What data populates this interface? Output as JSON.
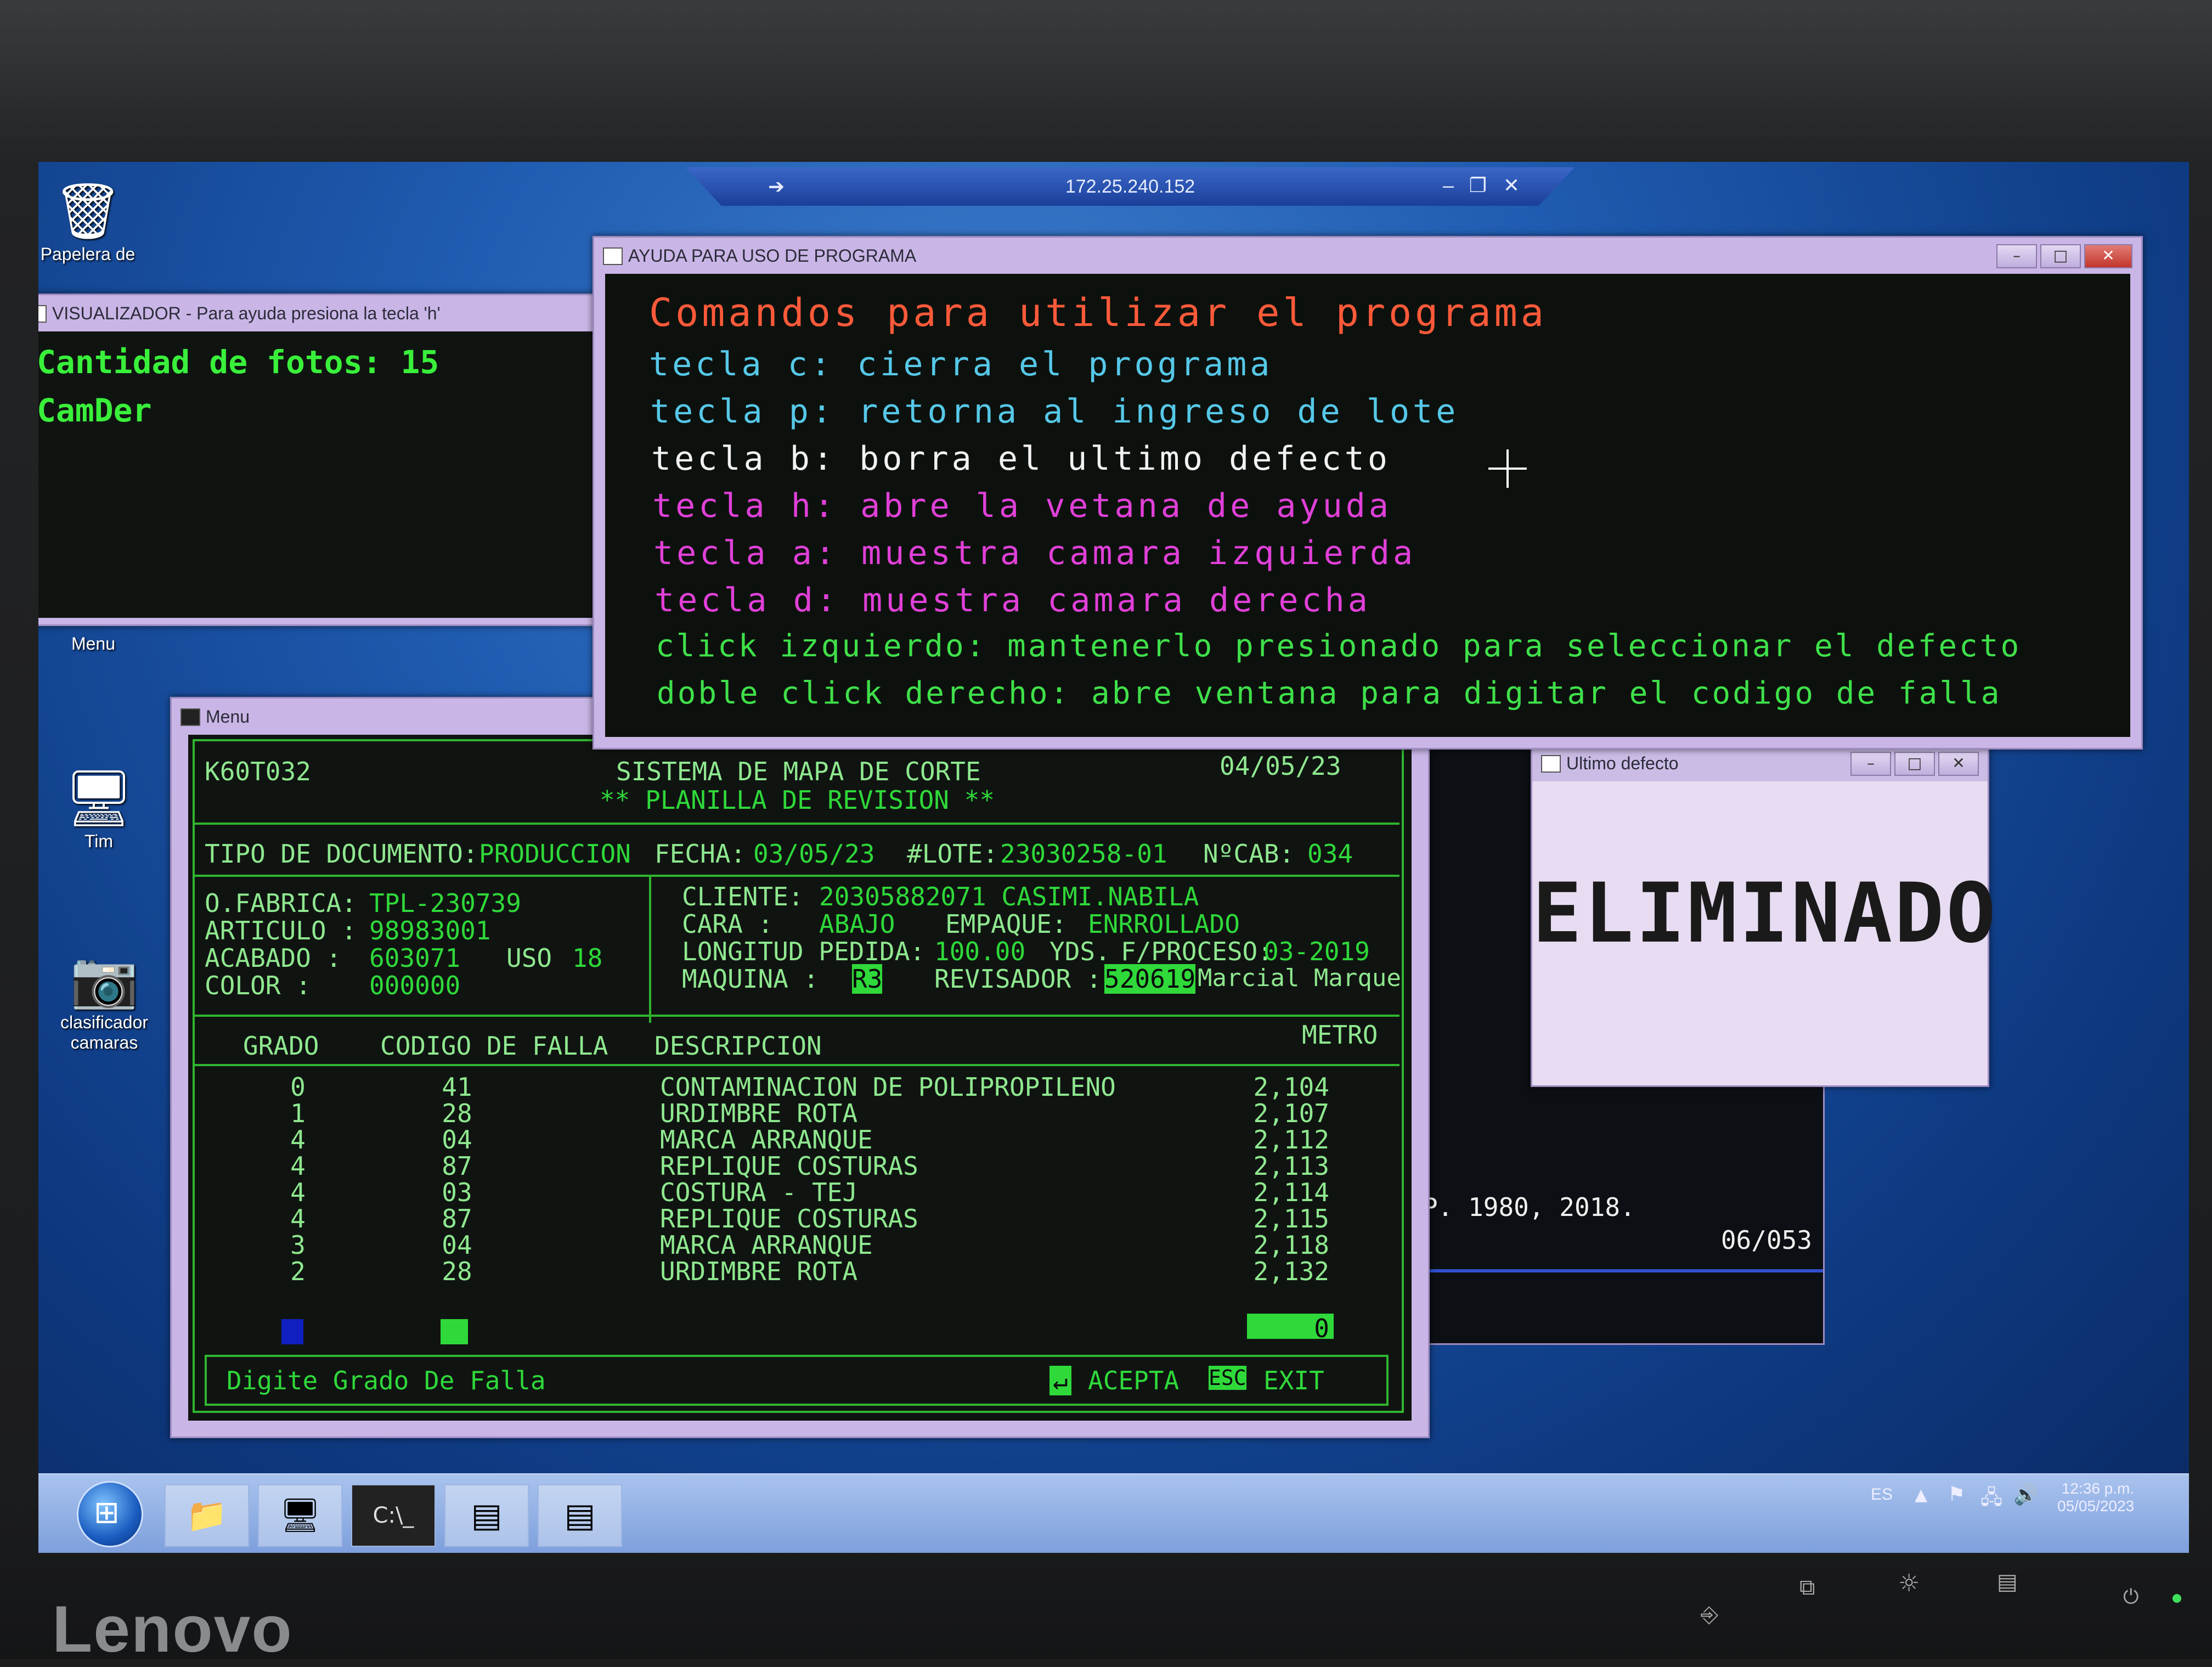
{
  "rdp": {
    "ip": "172.25.240.152",
    "pin_icon": "pin-icon",
    "min": "–",
    "restore": "❐",
    "close": "✕"
  },
  "desktop": {
    "recycle_label": "Papelera de",
    "menu_label": "Menu",
    "tim_label": "Tim",
    "clasificador_label": "clasificador camaras"
  },
  "visualizador": {
    "title": "VISUALIZADOR - Para ayuda presiona la tecla 'h'",
    "line1": "Cantidad de fotos: 15",
    "line2": "CamDer"
  },
  "help": {
    "title": "AYUDA PARA USO DE PROGRAMA",
    "heading": "Comandos para utilizar el programa",
    "lines": [
      {
        "text": "tecla c: cierra el programa",
        "color": "#56c8e8"
      },
      {
        "text": "tecla p: retorna al ingreso de lote",
        "color": "#56c8e8"
      },
      {
        "text": "tecla b: borra el ultimo defecto",
        "color": "#f2f2f2"
      },
      {
        "text": "tecla h: abre la vetana de ayuda",
        "color": "#e040d8"
      },
      {
        "text": "tecla a: muestra camara izquierda",
        "color": "#e040d8"
      },
      {
        "text": "tecla d: muestra camara derecha",
        "color": "#e040d8"
      },
      {
        "text": "click izquierdo: mantenerlo presionado para seleccionar el defecto",
        "color": "#3fe04a"
      },
      {
        "text": "doble click derecho: abre ventana para digitar el codigo de falla",
        "color": "#3fe04a"
      }
    ],
    "heading_color": "#ff5a3a"
  },
  "ultimo": {
    "title": "Ultimo defecto",
    "text": "ELIMINADO"
  },
  "bg_term": {
    "line1": "P. 1980, 2018.",
    "line2": "06/053"
  },
  "menu": {
    "title": "Menu",
    "program": "K60T032",
    "system": "SISTEMA DE MAPA DE CORTE",
    "subtitle": "** PLANILLA DE REVISION **",
    "date": "04/05/23",
    "tipo_label": "TIPO DE DOCUMENTO:",
    "tipo_value": "PRODUCCION",
    "fecha_label": "FECHA:",
    "fecha_value": "03/05/23",
    "lote_label": "#LOTE:",
    "lote_value": "23030258-01",
    "cab_label": "NºCAB:",
    "cab_value": "034",
    "ofab_label": "O.FABRICA:",
    "ofab_value": "TPL-230739",
    "art_label": "ARTICULO :",
    "art_value": "98983001",
    "acab_label": "ACABADO  :",
    "acab_value": "603071",
    "uso_label": "USO",
    "uso_value": "18",
    "color_label": "COLOR    :",
    "color_value": "000000",
    "cliente_label": "CLIENTE:",
    "cliente_value": "20305882071 CASIMI.NABILA",
    "cara_label": "CARA   :",
    "cara_value": "ABAJO",
    "empaque_label": "EMPAQUE:",
    "empaque_value": "ENRROLLADO",
    "long_label": "LONGITUD PEDIDA:",
    "long_value": "100.00",
    "yds_label": "YDS.",
    "fproc_label": "F/PROCESO:",
    "fproc_value": "03-2019",
    "maq_label": "MAQUINA :",
    "maq_value": "R3",
    "rev_label": "REVISADOR :",
    "rev_value": "520619",
    "rev_name": "Marcial Marque",
    "col_grado": "GRADO",
    "col_codigo": "CODIGO DE FALLA",
    "col_desc": "DESCRIPCION",
    "col_metro": "METRO",
    "rows": [
      {
        "grado": "0",
        "codigo": "41",
        "desc": "CONTAMINACION DE POLIPROPILENO",
        "metro": "2,104"
      },
      {
        "grado": "1",
        "codigo": "28",
        "desc": "URDIMBRE ROTA",
        "metro": "2,107"
      },
      {
        "grado": "4",
        "codigo": "04",
        "desc": "MARCA ARRANQUE",
        "metro": "2,112"
      },
      {
        "grado": "4",
        "codigo": "87",
        "desc": "REPLIQUE COSTURAS",
        "metro": "2,113"
      },
      {
        "grado": "4",
        "codigo": "03",
        "desc": "COSTURA - TEJ",
        "metro": "2,114"
      },
      {
        "grado": "4",
        "codigo": "87",
        "desc": "REPLIQUE COSTURAS",
        "metro": "2,115"
      },
      {
        "grado": "3",
        "codigo": "04",
        "desc": "MARCA ARRANQUE",
        "metro": "2,118"
      },
      {
        "grado": "2",
        "codigo": "28",
        "desc": "URDIMBRE ROTA",
        "metro": "2,132"
      }
    ],
    "metro_input": "0",
    "prompt": "Digite Grado De Falla",
    "acepta_label": "ACEPTA",
    "esc_key": "ESC",
    "exit_label": "EXIT"
  },
  "tray": {
    "lang": "ES",
    "time": "12:36 p.m.",
    "date": "05/05/2023"
  },
  "monitor": {
    "brand": "Lenovo"
  }
}
